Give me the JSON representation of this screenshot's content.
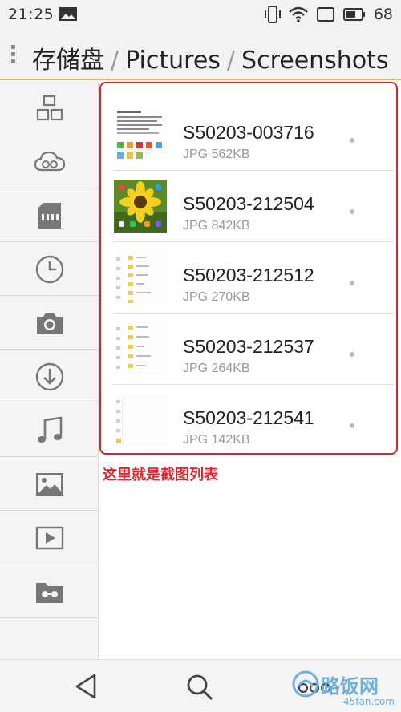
{
  "status_bar": {
    "time": "21:25",
    "battery": "68",
    "icons": [
      "image-icon",
      "vibrate-icon",
      "wifi-icon",
      "battery-icon"
    ]
  },
  "header": {
    "breadcrumb": [
      {
        "label": "存储盘"
      },
      {
        "label": "Pictures"
      },
      {
        "label": "Screenshots"
      }
    ],
    "separator": "/"
  },
  "sidebar": {
    "items": [
      {
        "icon": "category-icon"
      },
      {
        "icon": "cloud-icon"
      },
      {
        "icon": "sd-card-icon"
      },
      {
        "icon": "recent-clock-icon"
      },
      {
        "icon": "camera-icon"
      },
      {
        "icon": "download-icon"
      },
      {
        "icon": "music-icon"
      },
      {
        "icon": "picture-icon"
      },
      {
        "icon": "video-icon"
      },
      {
        "icon": "vr-folder-icon"
      }
    ]
  },
  "files": [
    {
      "name": "S50203-003716",
      "meta": "JPG 562KB"
    },
    {
      "name": "S50203-212504",
      "meta": "JPG 842KB"
    },
    {
      "name": "S50203-212512",
      "meta": "JPG 270KB"
    },
    {
      "name": "S50203-212537",
      "meta": "JPG 264KB"
    },
    {
      "name": "S50203-212541",
      "meta": "JPG 142KB"
    }
  ],
  "annotation": "这里就是截图列表",
  "watermark": {
    "text": "路饭网",
    "url": "45fan.com"
  },
  "colors": {
    "accent_line": "#f0b030",
    "highlight": "#d0262e",
    "annotation": "#e0262e"
  }
}
